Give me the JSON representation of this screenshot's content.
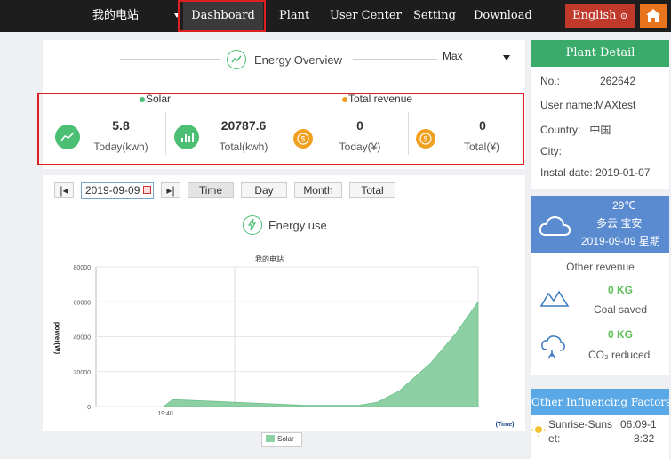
{
  "nav": {
    "plant_name": "我的电站",
    "dashboard": "Dashboard",
    "plant": "Plant",
    "user_center": "User Center",
    "setting": "Setting",
    "download": "Download",
    "language": "English",
    "language_icon": "circle-arrow-icon",
    "home_icon": "home-icon"
  },
  "overview": {
    "title": "Energy Overview",
    "select_value": "Max",
    "legend_solar": "Solar",
    "legend_revenue": "Total revenue",
    "solar_color": "#4bbf73",
    "revenue_color": "#f0a020",
    "stats": [
      {
        "value": "5.8",
        "label": "Today(kwh)"
      },
      {
        "value": "20787.6",
        "label": "Total(kwh)"
      },
      {
        "value": "0",
        "label": "Today(¥)"
      },
      {
        "value": "0",
        "label": "Total(¥)"
      }
    ]
  },
  "chart_toolbar": {
    "prev": "|◂",
    "date": "2019-09-09",
    "next": "▸|",
    "time": "Time",
    "day": "Day",
    "month": "Month",
    "total": "Total"
  },
  "energy_use_title": "Energy use",
  "chart_data": {
    "type": "area",
    "title": "我的电站",
    "ylabel": "power(W)",
    "xlabel": "(Time)",
    "x_tick": "19:40",
    "yticks": [
      "0",
      "20000",
      "40000",
      "60000",
      "80000"
    ],
    "ylim": [
      0,
      80000
    ],
    "series": [
      {
        "name": "Solar",
        "color": "#8cd0a4",
        "points": [
          [
            0.0,
            0
          ],
          [
            0.03,
            4000
          ],
          [
            0.45,
            700
          ],
          [
            0.62,
            700
          ],
          [
            0.68,
            2500
          ],
          [
            0.75,
            9000
          ],
          [
            0.85,
            25000
          ],
          [
            0.93,
            42000
          ],
          [
            1.0,
            60000
          ]
        ]
      }
    ]
  },
  "plant_detail": {
    "title": "Plant Detail",
    "no_label": "No.:",
    "no_value": "262642",
    "user_label": "User name:",
    "user_value": "MAXtest",
    "country_label": "Country:",
    "country_value": "中国",
    "city_label": "City:",
    "instal_label": "Instal date:",
    "instal_value": "2019-01-07"
  },
  "weather": {
    "temp": "29℃",
    "desc": "多云 宝安",
    "date": "2019-09-09 星期"
  },
  "other_revenue": {
    "title": "Other revenue",
    "coal_value": "0 KG",
    "coal_label": "Coal saved",
    "co2_value": "0 KG",
    "co2_label": "CO₂ reduced"
  },
  "factors": {
    "title": "Other Influencing Factors",
    "sunrise_label": "Sunrise-Suns",
    "sunrise_label2": "et:",
    "sunrise_value": "06:09-1",
    "sunset_value": "8:32"
  }
}
